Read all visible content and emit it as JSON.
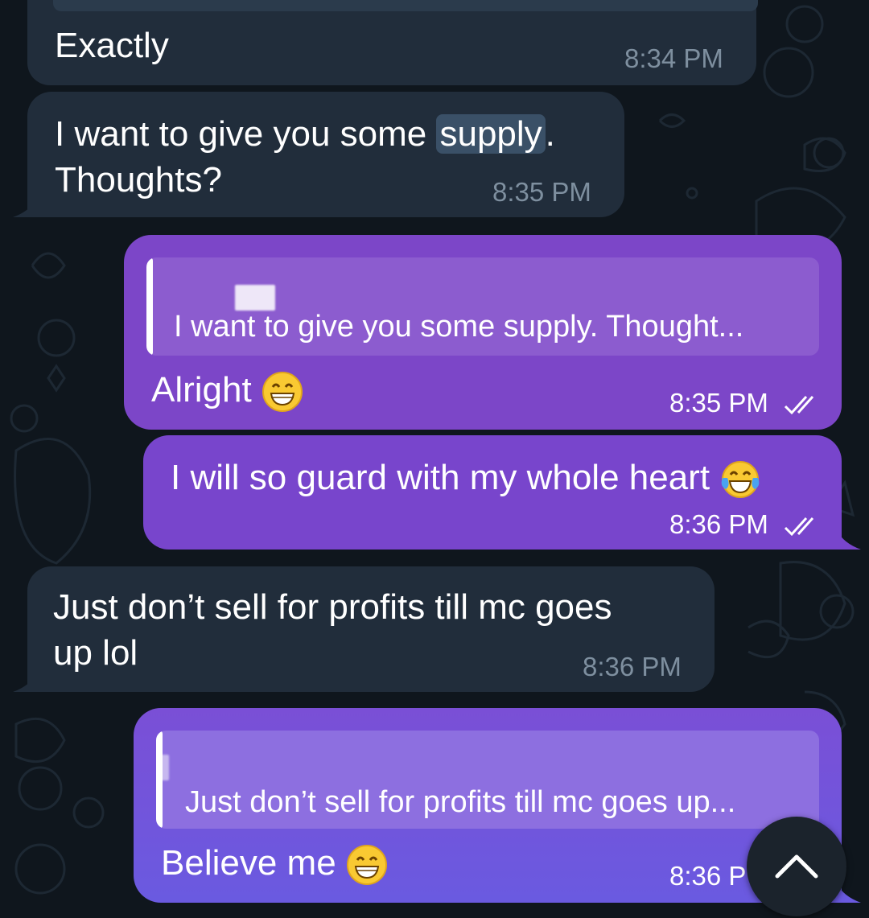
{
  "messages": [
    {
      "type": "incoming",
      "text": "Exactly",
      "time": "8:34 PM"
    },
    {
      "type": "incoming",
      "text_before": "I want to give you some ",
      "highlight": "supply",
      "text_after": ".",
      "line2": "Thoughts?",
      "time": "8:35 PM"
    },
    {
      "type": "outgoing",
      "reply_quote": "I want to give you some supply. Thought...",
      "text": "Alright",
      "emoji": "grinning-face-with-smiling-eyes",
      "time": "8:35 PM",
      "status": "read"
    },
    {
      "type": "outgoing",
      "text": "I will so guard with my whole heart",
      "emoji": "face-with-tears-of-joy",
      "time": "8:36 PM",
      "status": "read"
    },
    {
      "type": "incoming",
      "text": "Just don’t sell for profits till mc goes",
      "line2": "up lol",
      "time": "8:36 PM"
    },
    {
      "type": "outgoing",
      "reply_quote": "Just don’t sell for profits till mc goes up...",
      "text": "Believe me",
      "emoji": "grinning-face-with-smiling-eyes",
      "time": "8:36 P"
    }
  ],
  "colors": {
    "background": "#0f161d",
    "incoming_bubble": "#212d3b",
    "outgoing_bubble": "#7b47c9",
    "outgoing_bubble_bottom": "#6a5ae0",
    "highlight": "#3a5067"
  },
  "scroll_button": {
    "icon": "chevron-up-icon"
  }
}
